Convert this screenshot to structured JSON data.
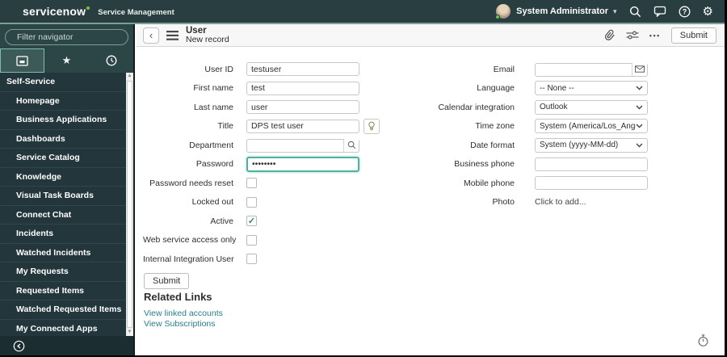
{
  "brand": {
    "logo_text": "servicenow",
    "product": "Service Management"
  },
  "header": {
    "user_name": "System Administrator"
  },
  "sidebar": {
    "filter_placeholder": "Filter navigator",
    "section_title": "Self-Service",
    "items": [
      "Homepage",
      "Business Applications",
      "Dashboards",
      "Service Catalog",
      "Knowledge",
      "Visual Task Boards",
      "Connect Chat",
      "Incidents",
      "Watched Incidents",
      "My Requests",
      "Requested Items",
      "Watched Requested Items",
      "My Connected Apps"
    ]
  },
  "form_header": {
    "title": "User",
    "subtitle": "New record",
    "submit_label": "Submit",
    "more_label": "•••",
    "back_glyph": "‹"
  },
  "form": {
    "left_fields": [
      {
        "label": "User ID",
        "value": "testuser"
      },
      {
        "label": "First name",
        "value": "test"
      },
      {
        "label": "Last name",
        "value": "user"
      },
      {
        "label": "Title",
        "value": "DPS test user"
      },
      {
        "label": "Department",
        "value": ""
      },
      {
        "label": "Password",
        "value": "••••••••"
      }
    ],
    "checkboxes": [
      {
        "label": "Password needs reset",
        "checked": false
      },
      {
        "label": "Locked out",
        "checked": false
      },
      {
        "label": "Active",
        "checked": true
      },
      {
        "label": "Web service access only",
        "checked": false
      },
      {
        "label": "Internal Integration User",
        "checked": false
      }
    ],
    "right_fields": [
      {
        "label": "Email",
        "value": ""
      },
      {
        "label": "Language",
        "value": "-- None --"
      },
      {
        "label": "Calendar integration",
        "value": "Outlook"
      },
      {
        "label": "Time zone",
        "value": "System (America/Los_Angeles)"
      },
      {
        "label": "Date format",
        "value": "System (yyyy-MM-dd)"
      },
      {
        "label": "Business phone",
        "value": ""
      },
      {
        "label": "Mobile phone",
        "value": ""
      },
      {
        "label": "Photo",
        "value": "Click to add..."
      }
    ],
    "submit_label": "Submit",
    "related_links": {
      "title": "Related Links",
      "links": [
        "View linked accounts",
        "View Subscriptions"
      ]
    }
  },
  "icons": {
    "star": "★",
    "gear": "⚙",
    "caret_down": "▾",
    "scroll_up": "▲",
    "scroll_down": "▼"
  },
  "colors": {
    "accent": "#4db3a0",
    "link": "#287f8c",
    "header_bg": "#293e41",
    "sidebar_bg": "#2c4547",
    "menu_bg": "#22363b"
  }
}
